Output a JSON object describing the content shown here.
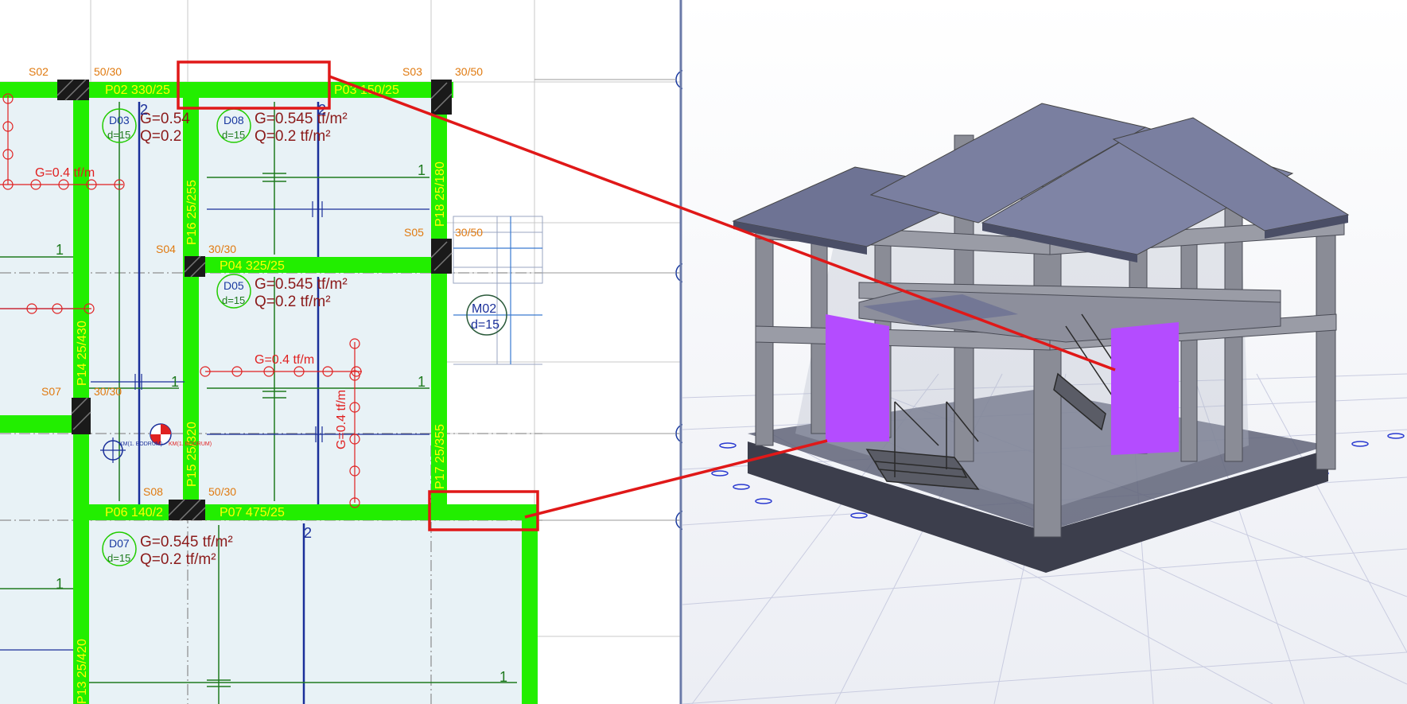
{
  "colors": {
    "beam": "#22ee00",
    "beam_label": "#ffff00",
    "column_label": "#e07a10",
    "slab_fill": "#e8f2f6",
    "load_text": "#8b1a1a",
    "slab_id": "#1a3aa0",
    "highlight": "#e01818",
    "wall_panel": "#b44cff",
    "tie_beam": "#1a2f9a",
    "dim_green": "#1f7a1f"
  },
  "plan": {
    "columns": [
      {
        "id": "S02",
        "size": "50/30"
      },
      {
        "id": "S03",
        "size": "30/50"
      },
      {
        "id": "S04",
        "size": "30/30"
      },
      {
        "id": "S05",
        "size": "30/50"
      },
      {
        "id": "S07",
        "size": "30/30"
      },
      {
        "id": "S08",
        "size": "50/30"
      }
    ],
    "beams": [
      {
        "label": "P02  330/25"
      },
      {
        "label": "P03 150/25"
      },
      {
        "label": "P04   325/25"
      },
      {
        "label": "P06 140/2"
      },
      {
        "label": "P07    475/25"
      },
      {
        "label": "P16 25/255"
      },
      {
        "label": "P18  25/180"
      },
      {
        "label": "P14  25/430"
      },
      {
        "label": "P15  25/320"
      },
      {
        "label": "P17  25/355"
      },
      {
        "label": "P13  25/420"
      }
    ],
    "slabs": [
      {
        "id": "D03",
        "d": "d=15",
        "g": "G=0.54",
        "q": "Q=0.2"
      },
      {
        "id": "D08",
        "d": "d=15",
        "g": "G=0.545 tf/m²",
        "q": "Q=0.2 tf/m²"
      },
      {
        "id": "D05",
        "d": "d=15",
        "g": "G=0.545 tf/m²",
        "q": "Q=0.2 tf/m²"
      },
      {
        "id": "D07",
        "d": "d=15",
        "g": "G=0.545 tf/m²",
        "q": "Q=0.2 tf/m²"
      }
    ],
    "wall": {
      "id": "M02",
      "d": "d=15"
    },
    "line_loads": [
      "G=0.4  tf/m",
      "G=0.4  tf/m",
      "G=0.4  tf/m"
    ],
    "axis_marks": [
      "1",
      "1",
      "1",
      "1",
      "1",
      "1",
      "1",
      "2",
      "2",
      "2"
    ],
    "small_label": "KM(1. BODRUM)",
    "small_label2": "KM(1. BODRUM)"
  }
}
